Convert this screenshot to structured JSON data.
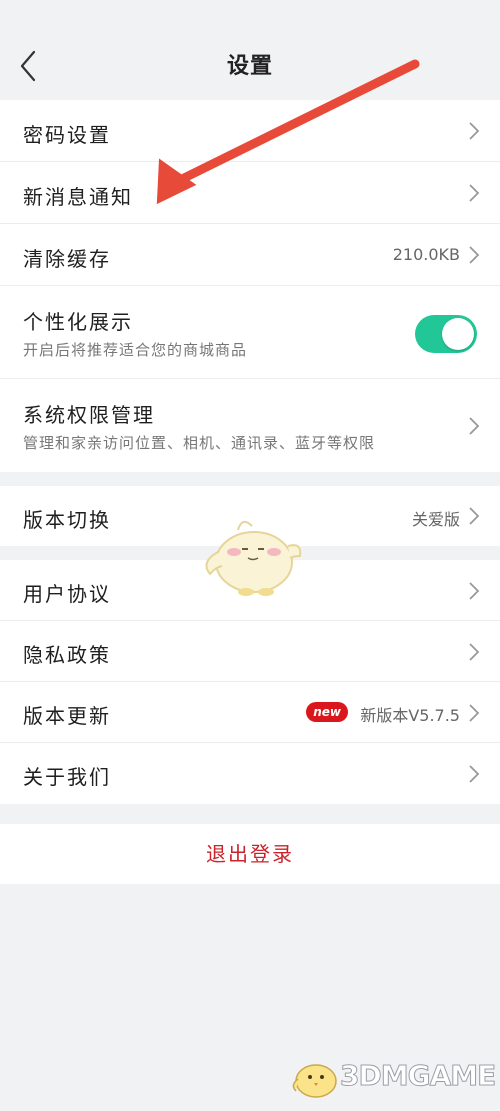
{
  "header": {
    "title": "设置"
  },
  "group1": {
    "password": {
      "label": "密码设置"
    },
    "notify": {
      "label": "新消息通知"
    },
    "cache": {
      "label": "清除缓存",
      "value": "210.0KB"
    },
    "personal": {
      "label": "个性化展示",
      "sub": "开启后将推荐适合您的商城商品",
      "toggle_on": true
    },
    "permission": {
      "label": "系统权限管理",
      "sub": "管理和家亲访问位置、相机、通讯录、蓝牙等权限"
    }
  },
  "group2": {
    "version_switch": {
      "label": "版本切换",
      "value": "关爱版"
    }
  },
  "group3": {
    "agreement": {
      "label": "用户协议"
    },
    "privacy": {
      "label": "隐私政策"
    },
    "update": {
      "label": "版本更新",
      "badge": "new",
      "value": "新版本V5.7.5"
    },
    "about": {
      "label": "关于我们"
    }
  },
  "logout": {
    "label": "退出登录"
  },
  "watermark": {
    "text": "3DMGAME"
  },
  "colors": {
    "accent": "#22c797",
    "danger": "#c9242b",
    "badge": "#d9171c",
    "annotation": "#e84a3a"
  },
  "icons": [
    "back-icon",
    "chevron-right-icon",
    "annotation-arrow",
    "mascot-sticker",
    "watermark-logo"
  ]
}
